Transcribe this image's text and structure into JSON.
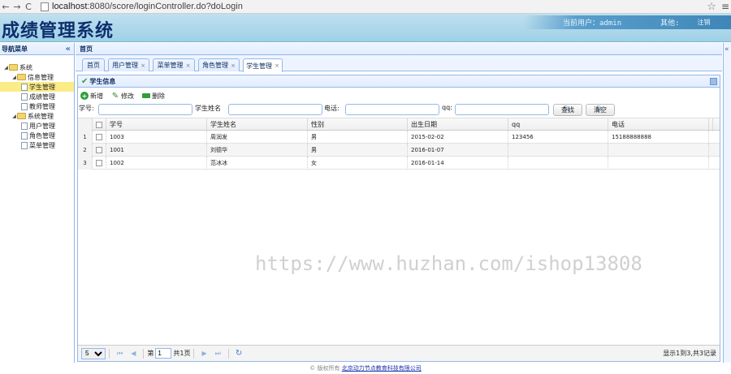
{
  "browser": {
    "url_host": "localhost",
    "url_rest": ":8080/score/loginController.do?doLogin"
  },
  "header": {
    "brand": "成绩管理系统",
    "current_user_label": "当前用户：",
    "current_user": "admin",
    "other_label": "其他:",
    "logout_label": "注销"
  },
  "sidebar": {
    "title": "导航菜单",
    "tree": [
      {
        "label": "系统",
        "level": 0,
        "type": "folder"
      },
      {
        "label": "信息管理",
        "level": 1,
        "type": "folder"
      },
      {
        "label": "学生管理",
        "level": 2,
        "type": "file",
        "selected": true
      },
      {
        "label": "成绩管理",
        "level": 2,
        "type": "file"
      },
      {
        "label": "教师管理",
        "level": 2,
        "type": "file"
      },
      {
        "label": "系统管理",
        "level": 1,
        "type": "folder"
      },
      {
        "label": "用户管理",
        "level": 2,
        "type": "file"
      },
      {
        "label": "角色管理",
        "level": 2,
        "type": "file"
      },
      {
        "label": "菜单管理",
        "level": 2,
        "type": "file"
      }
    ]
  },
  "main": {
    "breadcrumb": "首页",
    "tabs": [
      {
        "label": "首页",
        "closable": false
      },
      {
        "label": "用户管理",
        "closable": true
      },
      {
        "label": "菜单管理",
        "closable": true
      },
      {
        "label": "角色管理",
        "closable": true
      },
      {
        "label": "学生管理",
        "closable": true,
        "active": true
      }
    ],
    "panel_title": "学生信息",
    "toolbar": {
      "add": "新增",
      "edit": "修改",
      "delete": "删除"
    },
    "search": {
      "student_no_label": "学号:",
      "student_name_label": "学生姓名",
      "phone_label": "电话:",
      "qq_label": "qq:",
      "query_button": "查找",
      "clear_button": "清空"
    },
    "grid": {
      "columns": [
        "学号",
        "学生姓名",
        "性别",
        "出生日期",
        "qq",
        "电话"
      ],
      "rows": [
        {
          "rownum": "1",
          "no": "1003",
          "name": "周润发",
          "sex": "男",
          "birth": "2015-02-02",
          "qq": "123456",
          "phone": "15188888888"
        },
        {
          "rownum": "2",
          "no": "1001",
          "name": "刘德华",
          "sex": "男",
          "birth": "2016-01-07",
          "qq": "",
          "phone": ""
        },
        {
          "rownum": "3",
          "no": "1002",
          "name": "范冰冰",
          "sex": "女",
          "birth": "2016-01-14",
          "qq": "",
          "phone": ""
        }
      ]
    },
    "watermark": "https://www.huzhan.com/ishop13808",
    "pager": {
      "page_size": "5",
      "page_prefix": "第",
      "page_value": "1",
      "page_suffix": "共1页",
      "info": "显示1到3,共3记录"
    }
  },
  "footer": {
    "copyright": "© 版权所有",
    "company": "北京动力节点教育科技有限公司"
  }
}
